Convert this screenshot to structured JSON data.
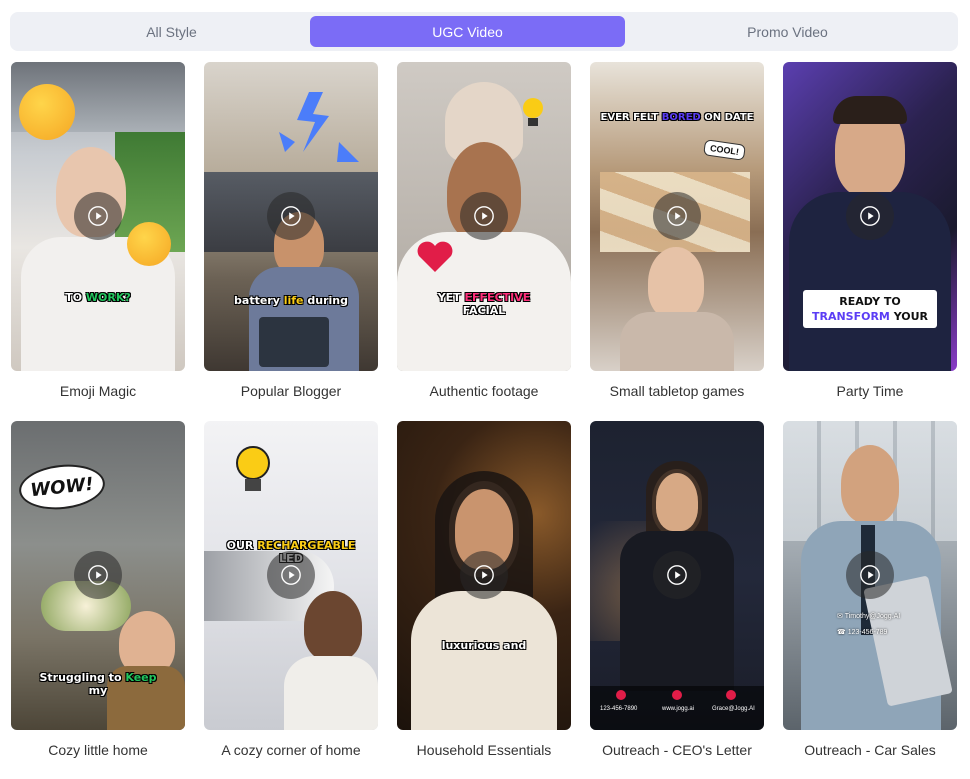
{
  "tabs": [
    {
      "label": "All Style",
      "active": false
    },
    {
      "label": "UGC Video",
      "active": true
    },
    {
      "label": "Promo Video",
      "active": false
    }
  ],
  "accent_color": "#7b6cf6",
  "cards": [
    {
      "label": "Emoji Magic",
      "caption": [
        "TO ",
        "WORK?"
      ]
    },
    {
      "label": "Popular Blogger",
      "caption": [
        "battery ",
        "life",
        " during"
      ]
    },
    {
      "label": "Authentic footage",
      "caption": [
        "YET ",
        "EFFECTIVE",
        "FACIAL"
      ]
    },
    {
      "label": "Small tabletop games",
      "caption_top": [
        "EVER FELT ",
        "BORED",
        " ON DATE"
      ],
      "badge": "COOL!"
    },
    {
      "label": "Party Time",
      "caption": [
        "READY TO",
        "TRANSFORM",
        " YOUR"
      ]
    },
    {
      "label": "Cozy little home",
      "caption": [
        "Struggling to ",
        "Keep",
        "my"
      ],
      "bubble": "WOW!"
    },
    {
      "label": "A cozy corner of home",
      "caption": [
        "OUR ",
        "RECHARGEABLE",
        "LED"
      ]
    },
    {
      "label": "Household Essentials",
      "caption": [
        "luxurious and"
      ]
    },
    {
      "label": "Outreach - CEO's Letter",
      "contacts": [
        "123-456-7890",
        "www.jogg.ai",
        "Grace@Jogg.AI"
      ]
    },
    {
      "label": "Outreach - Car Sales",
      "contacts": [
        "Timothy@Jogg.AI",
        "123-456-789"
      ]
    }
  ]
}
